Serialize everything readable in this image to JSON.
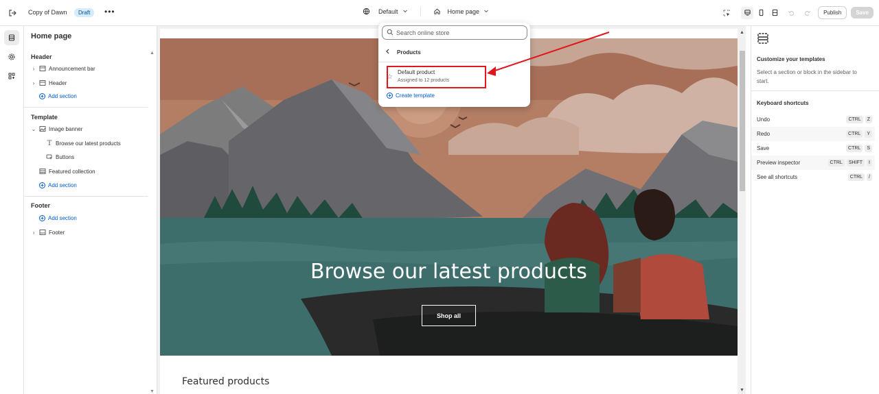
{
  "topbar": {
    "theme_name": "Copy of Dawn",
    "status_badge": "Draft",
    "more_label": "•••",
    "variant_selector": "Default",
    "page_selector": "Home page",
    "publish_label": "Publish",
    "save_label": "Save"
  },
  "sidebar": {
    "title": "Home page",
    "header_section": {
      "heading": "Header",
      "items": [
        {
          "label": "Announcement bar"
        },
        {
          "label": "Header"
        }
      ],
      "add_label": "Add section"
    },
    "template_section": {
      "heading": "Template",
      "items": [
        {
          "label": "Image banner"
        },
        {
          "label": "Browse our latest products"
        },
        {
          "label": "Buttons"
        },
        {
          "label": "Featured collection"
        }
      ],
      "add_label": "Add section"
    },
    "footer_section": {
      "heading": "Footer",
      "add_label": "Add section",
      "items": [
        {
          "label": "Footer"
        }
      ]
    }
  },
  "preview": {
    "hero_title": "Browse our latest products",
    "shop_button": "Shop all",
    "featured_heading": "Featured products"
  },
  "dropdown": {
    "search_placeholder": "Search online store",
    "back_label": "Products",
    "item_name": "Default product",
    "item_subtitle": "Assigned to 12 products",
    "create_label": "Create template"
  },
  "right_panel": {
    "title": "Customize your templates",
    "description": "Select a section or block in the sidebar to start.",
    "shortcuts_title": "Keyboard shortcuts",
    "shortcuts": [
      {
        "label": "Undo",
        "keys": [
          "CTRL",
          "Z"
        ]
      },
      {
        "label": "Redo",
        "keys": [
          "CTRL",
          "Y"
        ]
      },
      {
        "label": "Save",
        "keys": [
          "CTRL",
          "S"
        ]
      },
      {
        "label": "Preview inspector",
        "keys": [
          "CTRL",
          "SHIFT",
          "I"
        ]
      },
      {
        "label": "See all shortcuts",
        "keys": [
          "CTRL",
          "/"
        ]
      }
    ]
  },
  "colors": {
    "accent_link": "#005bd3",
    "badge_bg": "#d5ebff",
    "highlight_red": "#e0171d"
  }
}
